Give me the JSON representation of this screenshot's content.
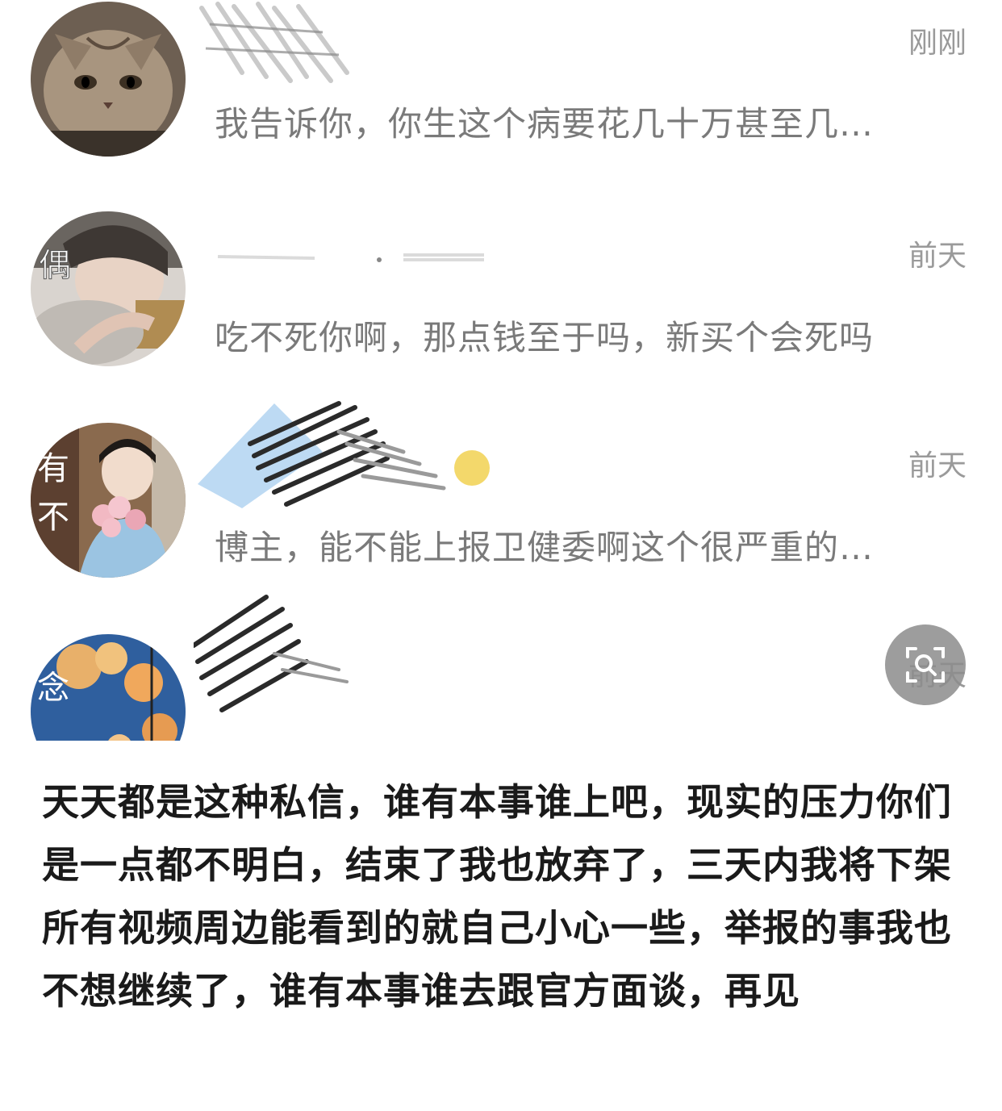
{
  "messages": [
    {
      "time": "刚刚",
      "preview": "我告诉你，你生这个病要花几十万甚至几…",
      "avatar_icon": "cat-avatar"
    },
    {
      "time": "前天",
      "preview": "吃不死你啊，那点钱至于吗，新买个会死吗",
      "avatar_icon": "person-avatar"
    },
    {
      "time": "前天",
      "preview": "博主，能不能上报卫健委啊这个很严重的…",
      "avatar_icon": "girl-with-flowers-avatar"
    },
    {
      "time": "前天",
      "preview": "",
      "avatar_icon": "sky-clouds-avatar"
    }
  ],
  "caption": "天天都是这种私信，谁有本事谁上吧，现实的压力你们是一点都不明白，结束了我也放弃了，三天内我将下架所有视频周边能看到的就自己小心一些，举报的事我也不想继续了，谁有本事谁去跟官方面谈，再见"
}
